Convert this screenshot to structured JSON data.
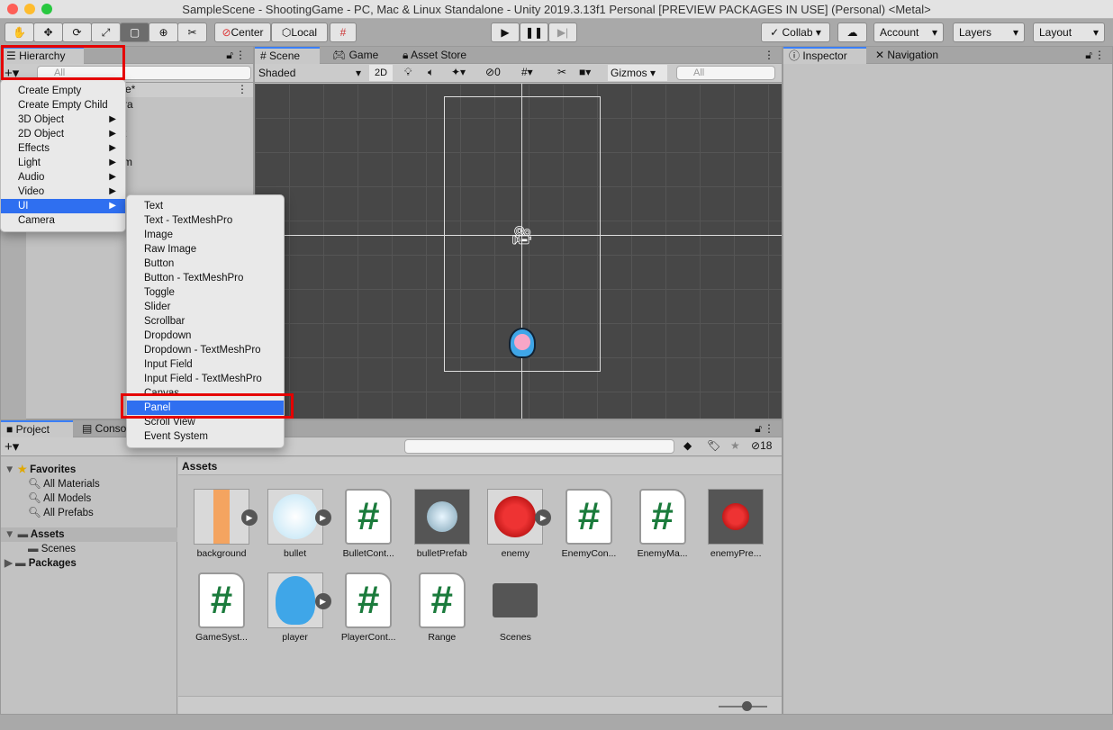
{
  "window": {
    "title": "SampleScene - ShootingGame - PC, Mac & Linux Standalone - Unity 2019.3.13f1 Personal [PREVIEW PACKAGES IN USE] (Personal) <Metal>"
  },
  "toolbar": {
    "pivot": "Center",
    "space": "Local",
    "collab": "Collab",
    "account": "Account",
    "layers": "Layers",
    "layout": "Layout"
  },
  "hierarchy": {
    "tab": "Hierarchy",
    "search_placeholder": "All",
    "scene_row": "e*",
    "partial_rows": [
      "ra",
      "t",
      "m"
    ]
  },
  "scene_view": {
    "tabs": [
      "Scene",
      "Game",
      "Asset Store"
    ],
    "shading": "Shaded",
    "mode2d": "2D",
    "hidden_count": "0",
    "gizmos": "Gizmos",
    "search_placeholder": "All"
  },
  "inspector": {
    "tabs": [
      "Inspector",
      "Navigation"
    ]
  },
  "create_menu": {
    "items": [
      {
        "label": "Create Empty"
      },
      {
        "label": "Create Empty Child"
      },
      {
        "label": "3D Object",
        "sub": true
      },
      {
        "label": "2D Object",
        "sub": true
      },
      {
        "label": "Effects",
        "sub": true
      },
      {
        "label": "Light",
        "sub": true
      },
      {
        "label": "Audio",
        "sub": true
      },
      {
        "label": "Video",
        "sub": true
      },
      {
        "label": "UI",
        "sub": true,
        "highlighted": true
      },
      {
        "label": "Camera"
      }
    ]
  },
  "ui_submenu": {
    "items": [
      {
        "label": "Text"
      },
      {
        "label": "Text - TextMeshPro"
      },
      {
        "label": "Image"
      },
      {
        "label": "Raw Image"
      },
      {
        "label": "Button"
      },
      {
        "label": "Button - TextMeshPro"
      },
      {
        "label": "Toggle"
      },
      {
        "label": "Slider"
      },
      {
        "label": "Scrollbar"
      },
      {
        "label": "Dropdown"
      },
      {
        "label": "Dropdown - TextMeshPro"
      },
      {
        "label": "Input Field"
      },
      {
        "label": "Input Field - TextMeshPro"
      },
      {
        "label": "Canvas"
      },
      {
        "label": "Panel",
        "highlighted": true
      },
      {
        "label": "Scroll View"
      },
      {
        "label": "Event System"
      }
    ]
  },
  "project": {
    "tabs": [
      "Project",
      "Console"
    ],
    "hidden_count": "18",
    "breadcrumb": "Assets",
    "tree": [
      {
        "label": "Favorites",
        "level": 0,
        "icon": "star"
      },
      {
        "label": "All Materials",
        "level": 1,
        "icon": "search"
      },
      {
        "label": "All Models",
        "level": 1,
        "icon": "search"
      },
      {
        "label": "All Prefabs",
        "level": 1,
        "icon": "search"
      },
      {
        "label": "Assets",
        "level": 0,
        "icon": "folder",
        "selected": true
      },
      {
        "label": "Scenes",
        "level": 1,
        "icon": "folder"
      },
      {
        "label": "Packages",
        "level": 0,
        "icon": "folder"
      }
    ],
    "assets": [
      {
        "label": "background",
        "kind": "sprite-bg",
        "expand": true
      },
      {
        "label": "bullet",
        "kind": "sprite-bullet",
        "expand": true
      },
      {
        "label": "BulletCont...",
        "kind": "script"
      },
      {
        "label": "bulletPrefab",
        "kind": "prefab-bullet"
      },
      {
        "label": "enemy",
        "kind": "sprite-enemy",
        "expand": true
      },
      {
        "label": "EnemyCon...",
        "kind": "script"
      },
      {
        "label": "EnemyMa...",
        "kind": "script"
      },
      {
        "label": "enemyPre...",
        "kind": "prefab-enemy"
      },
      {
        "label": "GameSyst...",
        "kind": "script"
      },
      {
        "label": "player",
        "kind": "sprite-player",
        "expand": true
      },
      {
        "label": "PlayerCont...",
        "kind": "script"
      },
      {
        "label": "Range",
        "kind": "script"
      },
      {
        "label": "Scenes",
        "kind": "folder"
      }
    ]
  },
  "colors": {
    "highlight": "#2f6ff0",
    "annotation": "#e50000",
    "script_hash": "#1b7b3c"
  }
}
